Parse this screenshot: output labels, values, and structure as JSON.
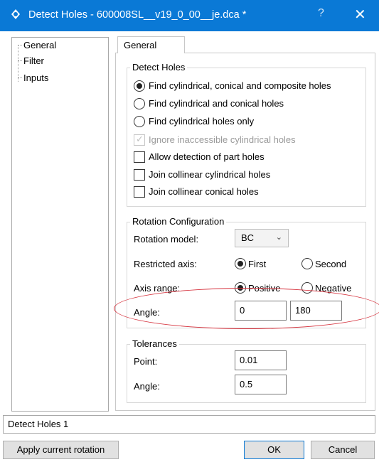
{
  "window": {
    "title": "Detect Holes - 600008SL__v19_0_00__je.dca *",
    "help_glyph": "?",
    "close_glyph": "✕"
  },
  "tree": {
    "items": [
      {
        "label": "General"
      },
      {
        "label": "Filter"
      },
      {
        "label": "Inputs"
      }
    ]
  },
  "tab": {
    "label": "General"
  },
  "detect_holes": {
    "legend": "Detect Holes",
    "options": [
      {
        "label": "Find cylindrical, conical and composite holes",
        "selected": true
      },
      {
        "label": "Find cylindrical and conical holes",
        "selected": false
      },
      {
        "label": "Find cylindrical holes only",
        "selected": false
      }
    ],
    "checkboxes": [
      {
        "label": "Ignore inaccessible cylindrical holes",
        "checked": true,
        "disabled": true
      },
      {
        "label": "Allow detection of part holes",
        "checked": false,
        "disabled": false
      },
      {
        "label": "Join collinear cylindrical holes",
        "checked": false,
        "disabled": false
      },
      {
        "label": "Join collinear conical holes",
        "checked": false,
        "disabled": false
      }
    ]
  },
  "rotation": {
    "legend": "Rotation Configuration",
    "model_label": "Rotation model:",
    "model_value": "BC",
    "restricted_label": "Restricted axis:",
    "restricted_first": "First",
    "restricted_second": "Second",
    "range_label": "Axis range:",
    "range_positive": "Positive",
    "range_negative": "Negative",
    "angle_label": "Angle:",
    "angle_min": "0",
    "angle_max": "180"
  },
  "tolerances": {
    "legend": "Tolerances",
    "point_label": "Point:",
    "point_value": "0.01",
    "angle_label": "Angle:",
    "angle_value": "0.5"
  },
  "status": {
    "text": "Detect Holes 1"
  },
  "buttons": {
    "apply_rotation": "Apply current rotation",
    "ok": "OK",
    "cancel": "Cancel"
  },
  "colors": {
    "titlebar": "#0a79d6",
    "highlight_ellipse": "#d6343f"
  }
}
